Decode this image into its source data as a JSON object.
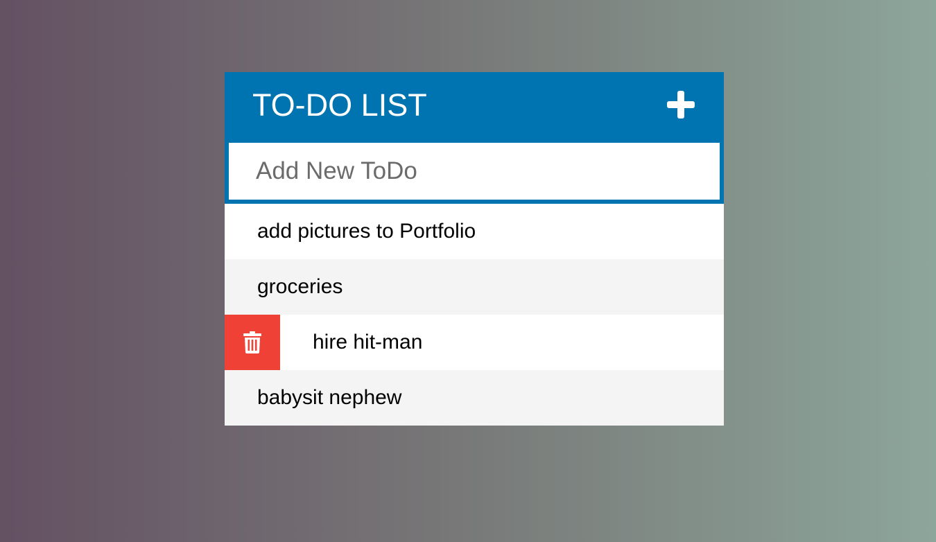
{
  "app": {
    "title": "TO-DO LIST",
    "add_icon": "plus-icon",
    "header_color": "#0074b1"
  },
  "input": {
    "placeholder": "Add New ToDo",
    "value": ""
  },
  "todos": [
    {
      "text": "add pictures to Portfolio"
    },
    {
      "text": "groceries"
    },
    {
      "text": "hire hit-man",
      "hovered": true,
      "delete_icon": "trash-icon",
      "delete_color": "#ef4136"
    },
    {
      "text": "babysit nephew"
    }
  ]
}
